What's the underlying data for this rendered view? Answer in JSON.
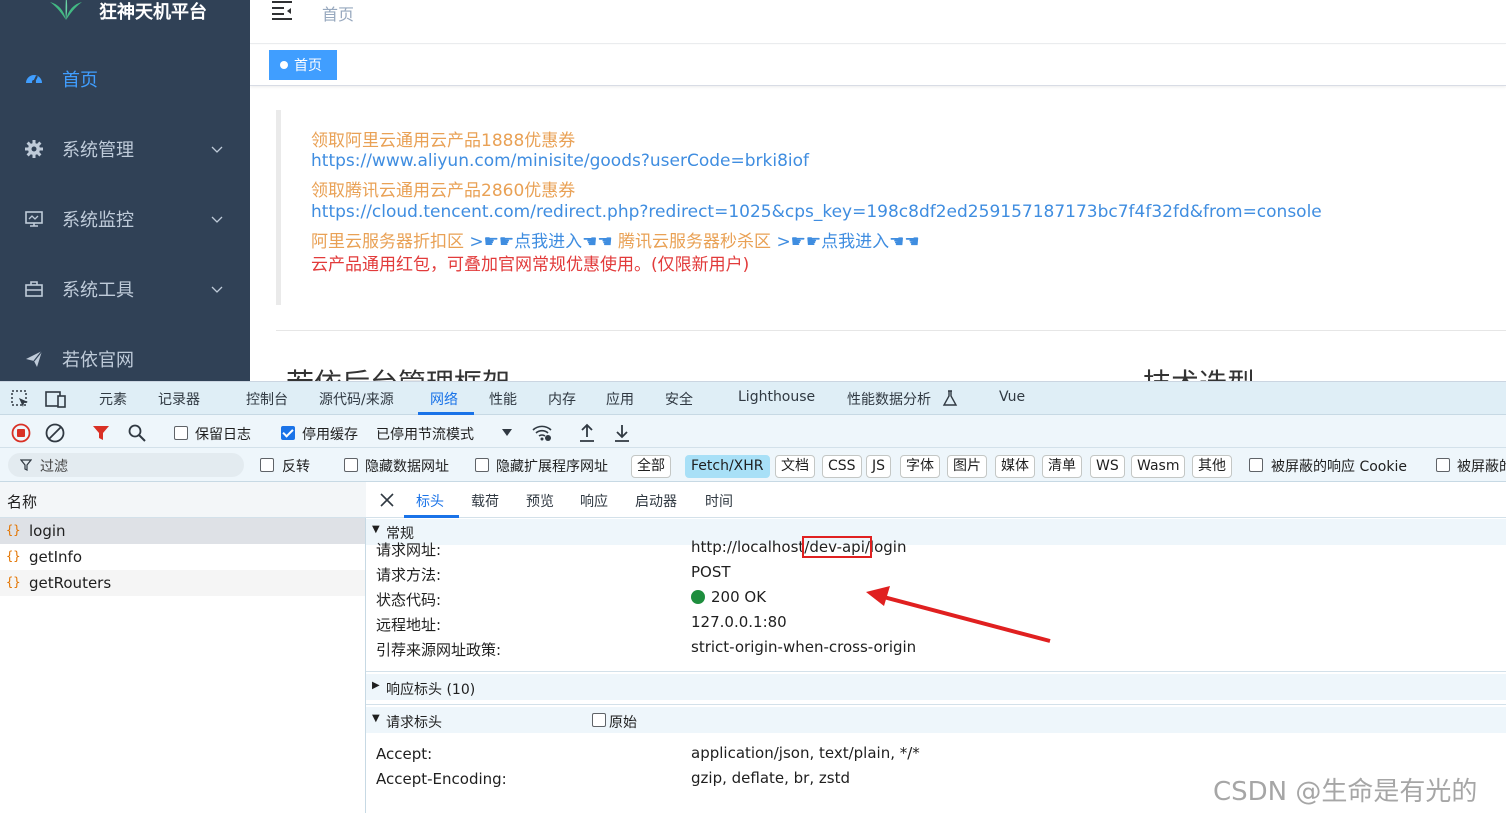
{
  "app": {
    "logo_title": "狂神天机平台",
    "menu": [
      {
        "label": "首页",
        "icon": "dashboard-icon",
        "active": true
      },
      {
        "label": "系统管理",
        "icon": "gear-icon",
        "active": false
      },
      {
        "label": "系统监控",
        "icon": "monitor-icon",
        "active": false
      },
      {
        "label": "系统工具",
        "icon": "toolbox-icon",
        "active": false
      },
      {
        "label": "若依官网",
        "icon": "paper-plane-icon",
        "active": false
      }
    ],
    "breadcrumb": "首页",
    "tag": "首页"
  },
  "notice": {
    "line1": "领取阿里云通用云产品1888优惠券",
    "line2": "https://www.aliyun.com/minisite/goods?userCode=brki8iof",
    "line3": "领取腾讯云通用云产品2860优惠券",
    "line4": "https://cloud.tencent.com/redirect.php?redirect=1025&cps_key=198c8df2ed259157187173bc7f4f32fd&from=console",
    "line5_part1": "阿里云服务器折扣区",
    "line5_link1": ">☛☛点我进入☚☚",
    "line5_part2": "腾讯云服务器秒杀区",
    "line5_link2": ">☛☛点我进入☚☚",
    "line6": "云产品通用红包，可叠加官网常规优惠使用。(仅限新用户)"
  },
  "headings": {
    "left": "若依后台管理框架",
    "right": "技术选型"
  },
  "devtools": {
    "tabs": [
      "元素",
      "记录器",
      "控制台",
      "源代码/来源",
      "网络",
      "性能",
      "内存",
      "应用",
      "安全",
      "Lighthouse",
      "性能数据分析",
      "Vue"
    ],
    "active_tab": "网络",
    "toolbar": {
      "preserve_log": "保留日志",
      "disable_cache": "停用缓存",
      "throttle": "已停用节流模式"
    },
    "filter": {
      "placeholder": "过滤",
      "invert": "反转",
      "hide_data_urls": "隐藏数据网址",
      "hide_ext_urls": "隐藏扩展程序网址",
      "types": [
        "全部",
        "Fetch/XHR",
        "文档",
        "CSS",
        "JS",
        "字体",
        "图片",
        "媒体",
        "清单",
        "WS",
        "Wasm",
        "其他"
      ],
      "active_type": "Fetch/XHR",
      "blocked_cookies": "被屏蔽的响应 Cookie",
      "blocked_requests": "被屏蔽的"
    },
    "requests_header": "名称",
    "requests": [
      "login",
      "getInfo",
      "getRouters"
    ],
    "detail_tabs": [
      "标头",
      "载荷",
      "预览",
      "响应",
      "启动器",
      "时间"
    ],
    "general": {
      "title": "常规",
      "rows": [
        {
          "key": "请求网址:",
          "value": ""
        },
        {
          "key": "请求方法:",
          "value": "POST"
        },
        {
          "key": "状态代码:",
          "value": "200 OK"
        },
        {
          "key": "远程地址:",
          "value": "127.0.0.1:80"
        },
        {
          "key": "引荐来源网址政策:",
          "value": "strict-origin-when-cross-origin"
        }
      ],
      "url_prefix": "http://localhost",
      "url_highlight": "/dev-api/",
      "url_suffix": "login"
    },
    "response_headers_title": "响应标头 (10)",
    "request_headers": {
      "title": "请求标头",
      "raw_label": "原始",
      "rows": [
        {
          "key": "Accept:",
          "value": "application/json, text/plain, */*"
        },
        {
          "key": "Accept-Encoding:",
          "value": "gzip, deflate, br, zstd"
        }
      ]
    }
  },
  "watermark": "CSDN @生命是有光的",
  "colors": {
    "sidebar_bg": "#304156",
    "accent": "#409eff",
    "annotation_red": "#e02020",
    "status_green": "#1e8e3e"
  }
}
